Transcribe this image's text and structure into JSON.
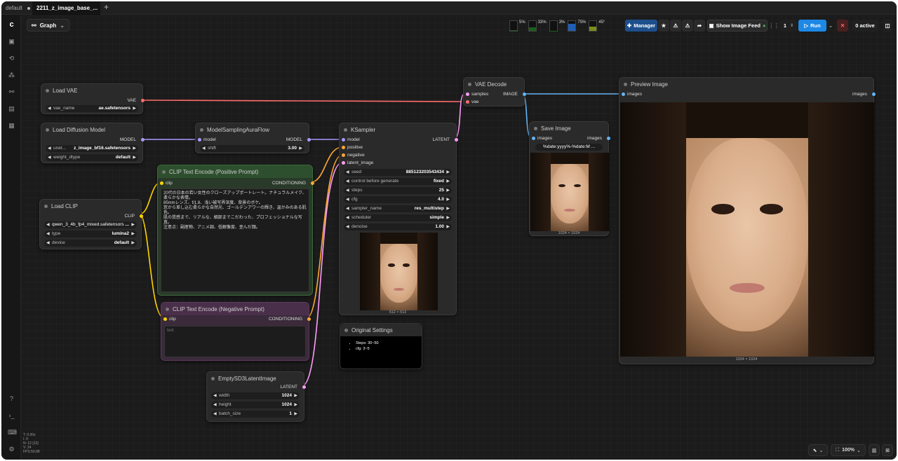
{
  "tabs": [
    {
      "label": "default"
    },
    {
      "label": "2211_z_image_base_..."
    }
  ],
  "toolbar": {
    "graph_label": "Graph",
    "monitors": [
      {
        "pct": "5%",
        "label": "CPU",
        "color": "#1a5f1a",
        "level": 0.05
      },
      {
        "pct": "33%",
        "label": "RAM",
        "color": "#1a5f1a",
        "level": 0.33
      },
      {
        "pct": "3%",
        "label": "GPU",
        "color": "#1a5f1a",
        "level": 0.03
      },
      {
        "pct": "75%",
        "label": "VRAM",
        "color": "#1f5fb4",
        "level": 0.75
      },
      {
        "pct": "45°",
        "label": "Temp",
        "color": "#7a8c1a",
        "level": 0.45
      }
    ],
    "manager_label": "Manager",
    "image_feed_label": "Show Image Feed",
    "batch_count": "1",
    "run_label": "Run",
    "active_label": "0 active",
    "zoom_label": "100%"
  },
  "stats": {
    "line1": "T: 0.00s",
    "line2": "I: 0",
    "line3": "N: 12 [12]",
    "line4": "V: 24",
    "line5": "FPS:59.88"
  },
  "nodes": {
    "load_vae": {
      "title": "Load VAE",
      "out": "VAE",
      "w_label": "vae_name",
      "w_value": "ae.safetensors"
    },
    "load_diffusion": {
      "title": "Load Diffusion Model",
      "out": "MODEL",
      "w1_label": "unet...",
      "w1_value": "z_image_bf16.safetensors",
      "w2_label": "weight_dtype",
      "w2_value": "default"
    },
    "model_sampling": {
      "title": "ModelSamplingAuraFlow",
      "in": "model",
      "out": "MODEL",
      "w_label": "shift",
      "w_value": "3.00"
    },
    "clip_pos": {
      "title": "CLIP Text Encode (Positive Prompt)",
      "in": "clip",
      "out": "CONDITIONING",
      "text": "20代の日本の若い女性のクローズアップポートレート。ナチュラルメイク、柔らかな表情。\n85mmレンズ、f/1.8、浅い被写界深度、背景のボケ。\n窓から差し込む柔らかな自然光、ゴールデンアワーの輝き、温かみのある肌色。\n肌の質感まで、リアルな、細部までこだわった、プロフェッショナルな写真。\n注意点：副産物、アニメ調、低解像度、歪んだ顔。"
    },
    "load_clip": {
      "title": "Load CLIP",
      "out": "CLIP",
      "w1_label": "qwen_3_4b_fp4_mixed.safetensors",
      "w1_value": "...",
      "w2_label": "type",
      "w2_value": "lumina2",
      "w3_label": "device",
      "w3_value": "default"
    },
    "clip_neg": {
      "title": "CLIP Text Encode (Negative Prompt)",
      "in": "clip",
      "out": "CONDITIONING",
      "placeholder": "text"
    },
    "ksampler": {
      "title": "KSampler",
      "in1": "model",
      "in2": "positive",
      "in3": "negative",
      "in4": "latent_image",
      "out": "LATENT",
      "widgets": [
        {
          "label": "seed",
          "value": "885123203543434"
        },
        {
          "label": "control before generate",
          "value": "fixed"
        },
        {
          "label": "steps",
          "value": "25"
        },
        {
          "label": "cfg",
          "value": "4.0"
        },
        {
          "label": "sampler_name",
          "value": "res_multistep"
        },
        {
          "label": "scheduler",
          "value": "simple"
        },
        {
          "label": "denoise",
          "value": "1.00"
        }
      ],
      "preview_caption": "512 × 512"
    },
    "vae_decode": {
      "title": "VAE Decode",
      "in1": "samples",
      "in2": "vae",
      "out": "IMAGE"
    },
    "save_image": {
      "title": "Save Image",
      "in": "images",
      "out": "images",
      "prefix": "%date:yyyy%-%date:M ...",
      "caption": "1024 × 1024"
    },
    "preview_image": {
      "title": "Preview Image",
      "in": "images",
      "out": "images",
      "caption": "1024 × 1024"
    },
    "original_settings": {
      "title": "Original Settings",
      "items": [
        "Steps: 30~50",
        "cfg: 3~5"
      ]
    },
    "empty_latent": {
      "title": "EmptySD3LatentImage",
      "out": "LATENT",
      "w1_label": "width",
      "w1_value": "1024",
      "w2_label": "height",
      "w2_value": "1024",
      "w3_label": "batch_size",
      "w3_value": "1"
    }
  }
}
